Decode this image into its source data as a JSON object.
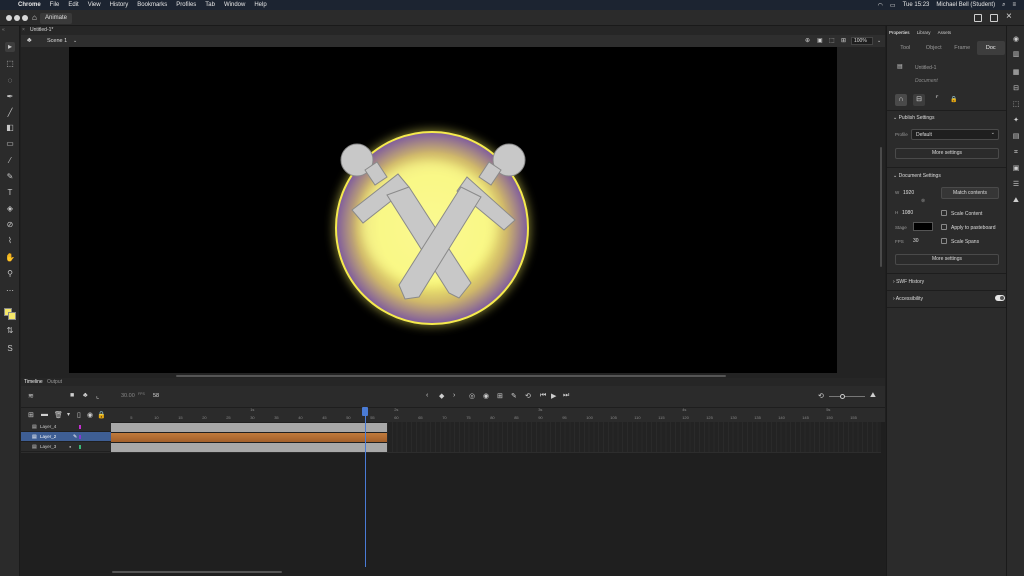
{
  "menubar": {
    "app": "Chrome",
    "items": [
      "File",
      "Edit",
      "View",
      "History",
      "Bookmarks",
      "Profiles",
      "Tab",
      "Window",
      "Help"
    ],
    "clock": "Tue 15:23",
    "user": "Michael Bell (Student)"
  },
  "appbar": {
    "tab_label": "Animate"
  },
  "document": {
    "tab_title": "Untitled-1*",
    "scene": "Scene 1",
    "zoom": "100%"
  },
  "timeline": {
    "tabs": [
      "Timeline",
      "Output"
    ],
    "fps": "30.00",
    "fps_unit": "FPS",
    "current_frame": "58",
    "layers": [
      {
        "name": "Layer_4",
        "color": "#c22fd1"
      },
      {
        "name": "Layer_2",
        "color": "#7f3ad1"
      },
      {
        "name": "Layer_3",
        "color": "#3ab877"
      }
    ],
    "ruler_ticks": [
      "1s",
      "5",
      "10",
      "15",
      "20",
      "25",
      "30",
      "35",
      "40",
      "45",
      "50",
      "55",
      "2s",
      "60",
      "65",
      "70",
      "75",
      "80",
      "85",
      "90",
      "3s",
      "95",
      "100",
      "105",
      "110",
      "115",
      "120",
      "125",
      "4s",
      "130",
      "135",
      "140",
      "145",
      "150",
      "5s",
      "155"
    ]
  },
  "properties": {
    "panel_tabs": [
      "Properties",
      "Library",
      "Assets"
    ],
    "tabs": [
      "Tool",
      "Object",
      "Frame",
      "Doc"
    ],
    "active_tab": "Doc",
    "doc_name": "Untitled-1",
    "doc_type": "Document",
    "publish_settings_title": "Publish Settings",
    "profile_label": "Profile",
    "profile_value": "Default",
    "more_settings_1": "More settings",
    "document_settings_title": "Document Settings",
    "width_label": "W",
    "width": "1920",
    "height_label": "H",
    "height": "1080",
    "match_contents": "Match contents",
    "scale_content": "Scale Content",
    "stage_label": "Stage",
    "stage_color": "#000000",
    "apply_pasteboard": "Apply to pasteboard",
    "fps_label": "FPS",
    "fps": "30",
    "scale_spans": "Scale Spans",
    "more_settings_2": "More settings",
    "swf_history": "SWF History",
    "accessibility": "Accessibility"
  },
  "colors": {
    "stroke": "#f5e76a",
    "fill": "#f5e76a",
    "stage_bg": "#000000",
    "glow": "#f6f47a",
    "ring": "#7d5a9e",
    "sword": "#c8c8c8"
  }
}
